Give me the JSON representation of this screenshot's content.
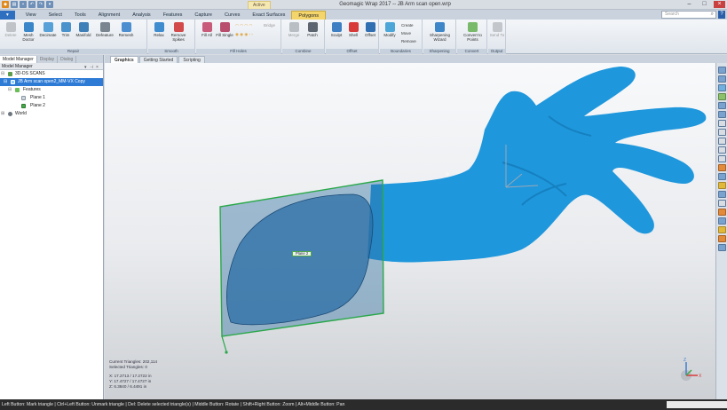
{
  "titlebar": {
    "title": "Geomagic Wrap 2017 -- JB Arm scan open.wrp",
    "context_tab": "Active",
    "quick_access": [
      "logo-icon",
      "open-icon",
      "save-icon",
      "undo-icon",
      "redo-icon",
      "more-icon"
    ]
  },
  "tabs": [
    "View",
    "Select",
    "Tools",
    "Alignment",
    "Analysis",
    "Features",
    "Capture",
    "Curves",
    "Exact Surfaces",
    "Polygons"
  ],
  "active_tab": "Polygons",
  "search": {
    "placeholder": "Search"
  },
  "help_label": "?",
  "ribbon": {
    "groups": [
      {
        "label": "Repair",
        "buttons": [
          "Delete",
          "Mesh Doctor",
          "Decimate",
          "Trim",
          "Manifold",
          "Defeature",
          "Remesh"
        ]
      },
      {
        "label": "Smooth",
        "buttons": [
          "Relax",
          "Remove Spikes"
        ]
      },
      {
        "label": "Fill Holes",
        "buttons": [
          "Fill All",
          "Fill Single"
        ],
        "small": [
          "Bridge"
        ]
      },
      {
        "label": "Combine",
        "buttons": [
          "Merge",
          "Patch"
        ]
      },
      {
        "label": "Offset",
        "buttons": [
          "Sculpt",
          "Shell",
          "Offset"
        ]
      },
      {
        "label": "Boundaries",
        "buttons": [
          "Modify"
        ],
        "small": [
          "Create",
          "Move",
          "Remove"
        ]
      },
      {
        "label": "Sharpening",
        "buttons": [
          "Sharpening Wizard"
        ]
      },
      {
        "label": "Convert",
        "buttons": [
          "Convert to Points"
        ]
      },
      {
        "label": "Output",
        "buttons": [
          "Send To"
        ]
      }
    ]
  },
  "panel": {
    "tabs": [
      "Model Manager",
      "Display",
      "Dialog"
    ],
    "header": "Model Manager",
    "tree": [
      {
        "label": "3D-DS SCANS",
        "level": 0
      },
      {
        "label": "JB Arm scan open2_MM-VX Copy",
        "level": 1,
        "selected": true
      },
      {
        "label": "Features",
        "level": 2
      },
      {
        "label": "Plane 1",
        "level": 3
      },
      {
        "label": "Plane 2",
        "level": 3
      },
      {
        "label": "World",
        "level": 0
      }
    ]
  },
  "view_tabs": [
    "Graphics",
    "Getting Started",
    "Scripting"
  ],
  "stats": {
    "current_triangles": "Current Triangles: 202,114",
    "selected_triangles": "Selected Triangles: 0",
    "x": "X: 17.2713 / 17.2722 in",
    "y": "Y: 17.4727 / 17.4727 in",
    "z": "Z: 6.3840 / 6.4491 in"
  },
  "plane_label": "Plane 2",
  "status_text": "Left Button: Mark triangle | Ctrl+Left Button: Unmark triangle | Del: Delete selected triangle(s) | Middle Button: Rotate | Shift+Right Button: Zoom | Alt+Middle Button: Pan",
  "colors": {
    "mesh": "#1f97dc",
    "plane_fill": "#2d6fa0",
    "plane_border": "#2aa84a",
    "ribbon_active": "#f3d56b",
    "selection": "#2e7bd6"
  }
}
